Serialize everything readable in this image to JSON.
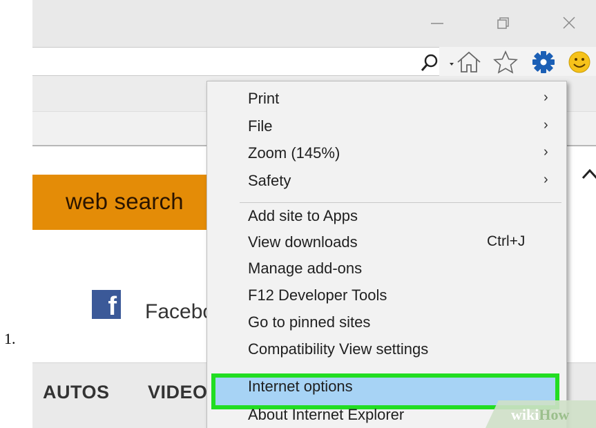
{
  "step": {
    "number": "1."
  },
  "window": {
    "controls": [
      "minimize-icon",
      "restore-icon",
      "close-icon"
    ],
    "toolbar_icons": [
      "search-icon",
      "chevron-down-icon",
      "home-icon",
      "star-icon",
      "gear-icon",
      "smiley-icon"
    ],
    "accent_gear": "#1b5fb5"
  },
  "page": {
    "search_button": "web search",
    "facebook_label": "Facebo",
    "nav": [
      "AUTOS",
      "VIDEO"
    ]
  },
  "menu": {
    "items": [
      {
        "label": "Print",
        "submenu": true
      },
      {
        "label": "File",
        "submenu": true
      },
      {
        "label": "Zoom (145%)",
        "submenu": true
      },
      {
        "label": "Safety",
        "submenu": true
      },
      {
        "label": "Add site to Apps"
      },
      {
        "label": "View downloads",
        "shortcut": "Ctrl+J"
      },
      {
        "label": "Manage add-ons"
      },
      {
        "label": "F12 Developer Tools"
      },
      {
        "label": "Go to pinned sites"
      },
      {
        "label": "Compatibility View settings"
      },
      {
        "label": "Internet options",
        "highlighted": true
      },
      {
        "label": "About Internet Explorer"
      }
    ],
    "highlight_color": "#22dd22"
  },
  "watermark": {
    "part1": "wiki",
    "part2": "How"
  }
}
